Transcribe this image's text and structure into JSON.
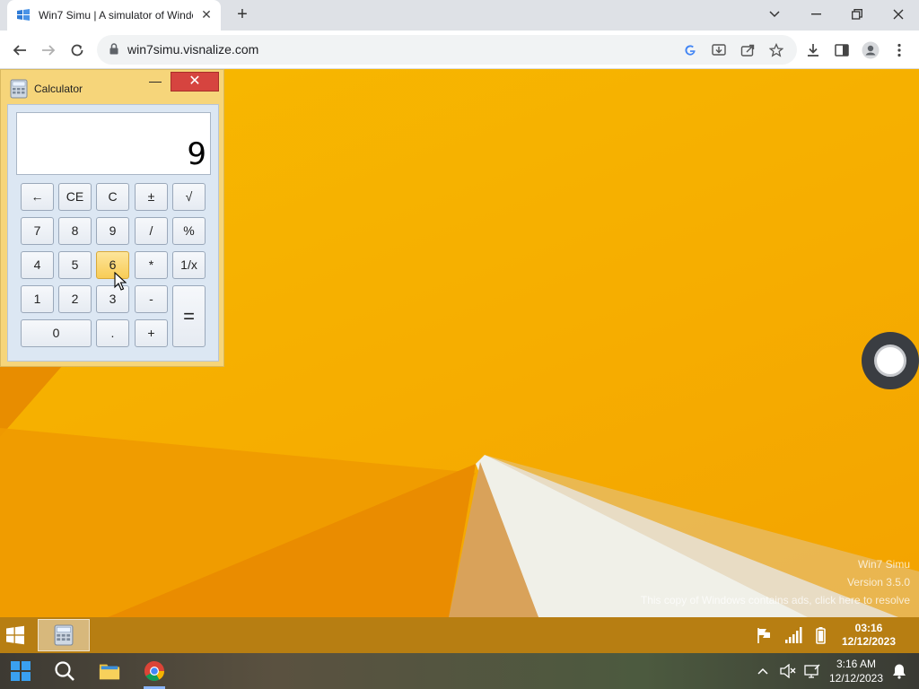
{
  "browser": {
    "tab_title": "Win7 Simu | A simulator of Windows",
    "url": "win7simu.visnalize.com"
  },
  "calculator": {
    "title": "Calculator",
    "display": "9",
    "keys": {
      "backspace": "←",
      "ce": "CE",
      "c": "C",
      "plusminus": "±",
      "sqrt": "√",
      "k7": "7",
      "k8": "8",
      "k9": "9",
      "div": "/",
      "pct": "%",
      "k4": "4",
      "k5": "5",
      "k6": "6",
      "mul": "*",
      "recip": "1/x",
      "k1": "1",
      "k2": "2",
      "k3": "3",
      "sub": "-",
      "eq": "=",
      "k0": "0",
      "dot": ".",
      "add": "+"
    }
  },
  "watermark": {
    "line1": "Win7 Simu",
    "line2": "Version 3.5.0",
    "line3": "This copy of Windows contains ads, click here to resolve"
  },
  "sim_taskbar": {
    "time": "03:16",
    "date": "12/12/2023"
  },
  "host_taskbar": {
    "time": "3:16 AM",
    "date": "12/12/2023"
  },
  "colors": {
    "desktop": "#f6ad00",
    "calc_frame": "#f6d57a",
    "close_red": "#d6443f"
  }
}
